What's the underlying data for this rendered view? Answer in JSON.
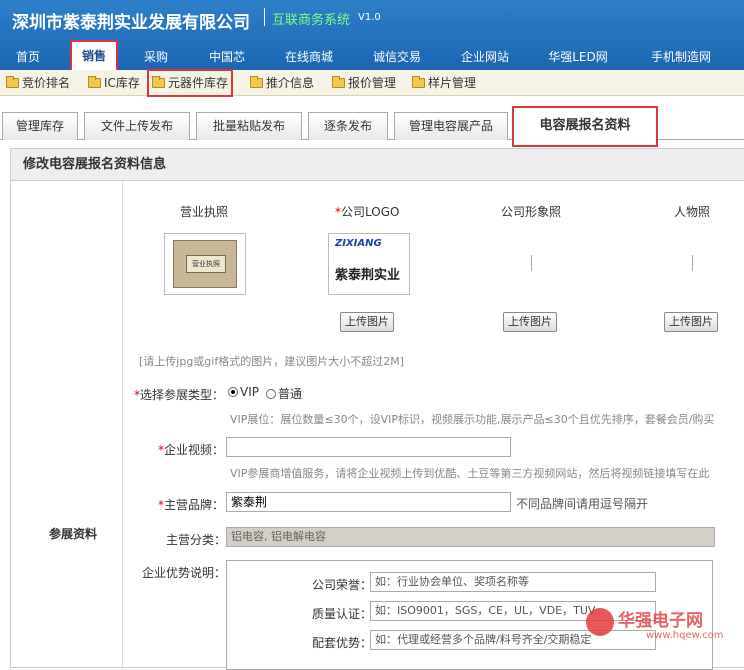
{
  "header": {
    "company": "深圳市紫泰荆实业发展有限公司",
    "system_name": "互联商务系统",
    "version": "V1.0"
  },
  "nav": [
    "首页",
    "销售",
    "采购",
    "中国芯",
    "在线商城",
    "诚信交易",
    "企业网站",
    "华强LED网",
    "手机制造网"
  ],
  "subnav": [
    "竞价排名",
    "IC库存",
    "元器件库存",
    "推介信息",
    "报价管理",
    "样片管理"
  ],
  "tabs": [
    "管理库存",
    "文件上传发布",
    "批量粘贴发布",
    "逐条发布",
    "管理电容展产品",
    "电容展报名资料"
  ],
  "panel": {
    "title": "修改电容展报名资料信息",
    "left_label": "参展资料"
  },
  "photos": {
    "labels": [
      "营业执照",
      "公司LOGO",
      "公司形象照",
      "人物照"
    ],
    "required_mark": "*",
    "upload_label": "上传图片",
    "logo_brand": "ZIXIANG",
    "logo_text": "紫泰荆实业",
    "license_text": "营业执照",
    "hint": "[请上传jpg或gif格式的图片，建议图片大小不超过2M]"
  },
  "form": {
    "type_label": "选择参展类型：",
    "opt_vip": "VIP",
    "opt_normal": "普通",
    "vip_desc": "VIP展位：展位数量≤30个，设VIP标识，视频展示功能,展示产品≤30个且优先排序，套餐会员/购买",
    "video_label": "企业视频：",
    "video_value": "",
    "video_desc": "VIP参展商增值服务，请将企业视频上传到优酷、土豆等第三方视频网站，然后将视频链接填写在此",
    "brand_label": "主营品牌：",
    "brand_value": "紫泰荆",
    "brand_hint": "不同品牌间请用逗号隔开",
    "category_label": "主营分类：",
    "category_value": "铝电容, 铝电解电容",
    "adv_label": "企业优势说明：",
    "honor_label": "公司荣誉：",
    "honor_placeholder": "如：行业协会单位、奖项名称等",
    "cert_label": "质量认证：",
    "cert_placeholder": "如：ISO9001，SGS，CE，UL，VDE，TUV...",
    "support_label": "配套优势：",
    "support_placeholder": "如：代理或经营多个品牌/料号齐全/交期稳定"
  },
  "watermark": {
    "text": "华强电子网",
    "url": "www.hqew.com"
  }
}
